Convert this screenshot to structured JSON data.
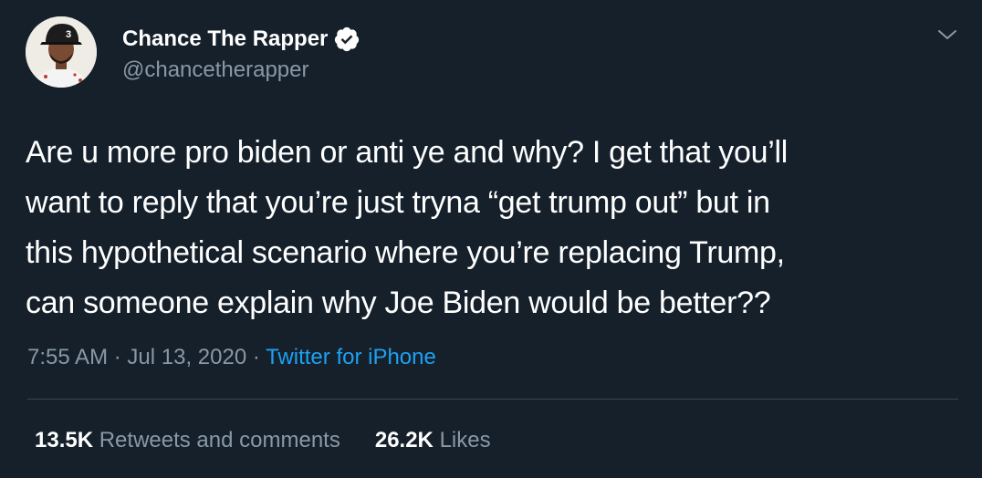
{
  "author": {
    "display_name": "Chance The Rapper",
    "handle": "@chancetherapper",
    "verified": true
  },
  "tweet": {
    "text_lines": [
      "Are u more pro biden or anti ye and why? I get that you’ll",
      "want to reply that you’re just tryna “get trump out” but in",
      "this hypothetical scenario where you’re replacing Trump,",
      "can someone explain why Joe Biden would be better??"
    ],
    "time": "7:55 AM",
    "separator": "·",
    "date": "Jul 13, 2020",
    "source": "Twitter for iPhone"
  },
  "stats": {
    "retweets_count": "13.5K",
    "retweets_label": "Retweets and comments",
    "likes_count": "26.2K",
    "likes_label": "Likes"
  },
  "colors": {
    "background": "#15202b",
    "text": "#ffffff",
    "secondary": "#8899a6",
    "accent": "#1da1f2",
    "divider": "#38444d"
  },
  "icons": {
    "verified": "verified-badge-icon",
    "menu": "chevron-down-icon"
  }
}
